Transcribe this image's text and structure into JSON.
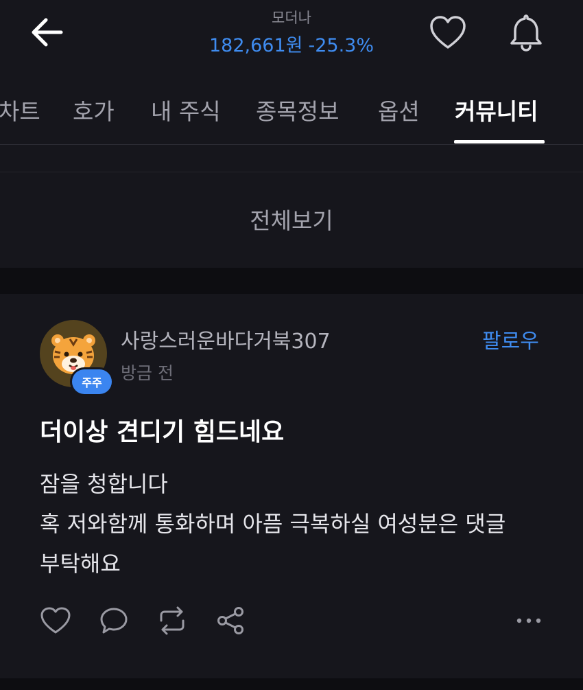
{
  "header": {
    "stock_name": "모더나",
    "price": "182,661원",
    "change": "-25.3%",
    "icons": [
      "back-arrow-icon",
      "heart-icon",
      "bell-icon"
    ]
  },
  "tabs": [
    {
      "label": "차트",
      "active": false
    },
    {
      "label": "호가",
      "active": false
    },
    {
      "label": "내 주식",
      "active": false
    },
    {
      "label": "종목정보",
      "active": false
    },
    {
      "label": "옵션",
      "active": false
    },
    {
      "label": "커뮤니티",
      "active": true
    }
  ],
  "filter": {
    "label": "전체보기"
  },
  "post": {
    "author": "사랑스러운바다거북307",
    "badge": "주주",
    "time": "방금 전",
    "follow_label": "팔로우",
    "title": "더이상 견디기 힘드네요",
    "body_lines": [
      "잠을 청합니다",
      "혹 저와함께 통화하며 아픔 극복하실 여성분은 댓글",
      "부탁해요"
    ],
    "action_icons": [
      "like-icon",
      "comment-icon",
      "repost-icon",
      "share-icon",
      "more-icon"
    ]
  },
  "colors": {
    "background": "#16161c",
    "accent_blue": "#3f8cf0",
    "muted_text": "#a3a3ad"
  }
}
